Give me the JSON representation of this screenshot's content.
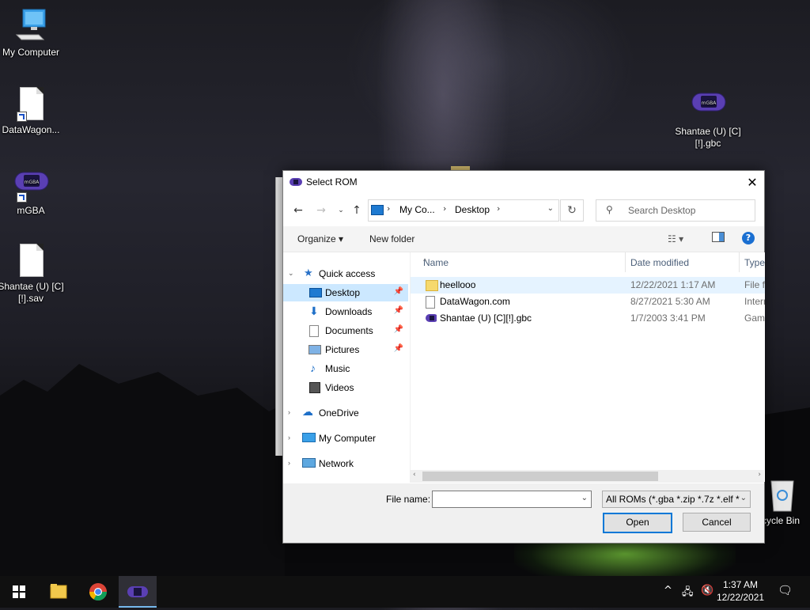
{
  "desktop": {
    "icons": [
      {
        "label": "My Computer"
      },
      {
        "label": "DataWagon..."
      },
      {
        "label": "mGBA"
      },
      {
        "label": "Shantae (U) [C][!].sav"
      },
      {
        "label": "Shantae (U) [C][!].gbc"
      },
      {
        "label": "cycle Bin"
      }
    ]
  },
  "dialog": {
    "title": "Select ROM",
    "close_label": "✕",
    "address": {
      "crumbs": [
        "My Co...",
        "Desktop"
      ]
    },
    "search_placeholder": "Search Desktop",
    "toolbar": {
      "organize": "Organize",
      "new_folder": "New folder"
    },
    "nav": {
      "quick_access": "Quick access",
      "items": [
        "Desktop",
        "Downloads",
        "Documents",
        "Pictures",
        "Music",
        "Videos"
      ],
      "roots": [
        "OneDrive",
        "My Computer",
        "Network"
      ]
    },
    "columns": {
      "name": "Name",
      "date": "Date modified",
      "type": "Type"
    },
    "files": [
      {
        "name": "heellooo",
        "date": "12/22/2021 1:17 AM",
        "type": "File fo",
        "icon": "folder-icon"
      },
      {
        "name": "DataWagon.com",
        "date": "8/27/2021 5:30 AM",
        "type": "Intern",
        "icon": "internet-shortcut-icon"
      },
      {
        "name": "Shantae (U) [C][!].gbc",
        "date": "1/7/2003 3:41 PM",
        "type": "Game",
        "icon": "gba-icon"
      }
    ],
    "file_name_label": "File name:",
    "file_name_value": "",
    "file_type": "All ROMs (*.gba *.zip *.7z *.elf *",
    "open_label": "Open",
    "cancel_label": "Cancel"
  },
  "taskbar": {
    "time": "1:37 AM",
    "date": "12/22/2021"
  }
}
